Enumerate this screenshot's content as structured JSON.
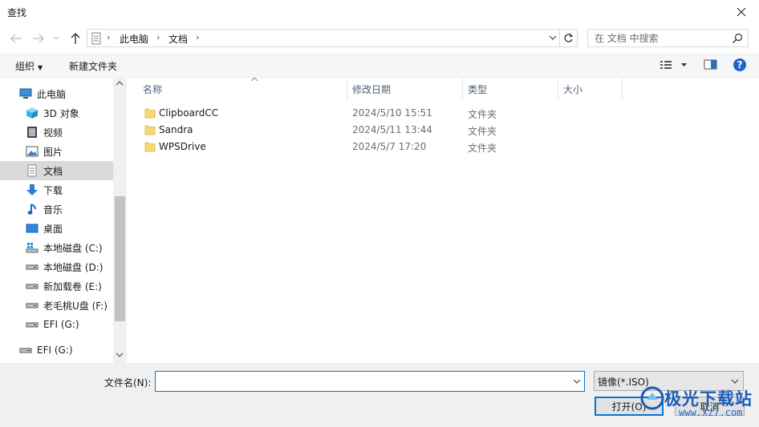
{
  "window": {
    "title": "查找"
  },
  "address": {
    "crumbs": [
      "此电脑",
      "文档"
    ]
  },
  "search": {
    "placeholder": "在 文档 中搜索"
  },
  "toolbar": {
    "organize": "组织",
    "new_folder": "新建文件夹"
  },
  "nav": {
    "items": [
      {
        "label": "此电脑",
        "icon": "computer-icon"
      },
      {
        "label": "3D 对象",
        "icon": "cube-3d-icon"
      },
      {
        "label": "视频",
        "icon": "video-icon"
      },
      {
        "label": "图片",
        "icon": "pictures-icon"
      },
      {
        "label": "文档",
        "icon": "document-icon",
        "selected": true
      },
      {
        "label": "下载",
        "icon": "download-icon"
      },
      {
        "label": "音乐",
        "icon": "music-icon"
      },
      {
        "label": "桌面",
        "icon": "desktop-icon"
      },
      {
        "label": "本地磁盘 (C:)",
        "icon": "windows-drive-icon"
      },
      {
        "label": "本地磁盘 (D:)",
        "icon": "drive-icon"
      },
      {
        "label": "新加载卷 (E:)",
        "icon": "drive-icon"
      },
      {
        "label": "老毛桃U盘 (F:)",
        "icon": "usb-drive-icon"
      },
      {
        "label": "EFI (G:)",
        "icon": "drive-icon"
      },
      {
        "label": "EFI (G:)",
        "icon": "drive-icon"
      }
    ]
  },
  "columns": {
    "name": "名称",
    "date": "修改日期",
    "type": "类型",
    "size": "大小"
  },
  "files": [
    {
      "name": "ClipboardCC",
      "date": "2024/5/10 15:51",
      "type": "文件夹"
    },
    {
      "name": "Sandra",
      "date": "2024/5/11 13:44",
      "type": "文件夹"
    },
    {
      "name": "WPSDrive",
      "date": "2024/5/7 17:20",
      "type": "文件夹"
    }
  ],
  "footer": {
    "filename_label": "文件名(N):",
    "filename_value": "",
    "filter": "镜像(*.ISO)",
    "open": "打开(O)",
    "cancel": "取消"
  },
  "watermark": {
    "text": "极光下载站",
    "url": "www.xz7.com"
  },
  "colors": {
    "accent": "#0078d7",
    "folder": "#f8d775",
    "selected": "#d9d9d9"
  }
}
